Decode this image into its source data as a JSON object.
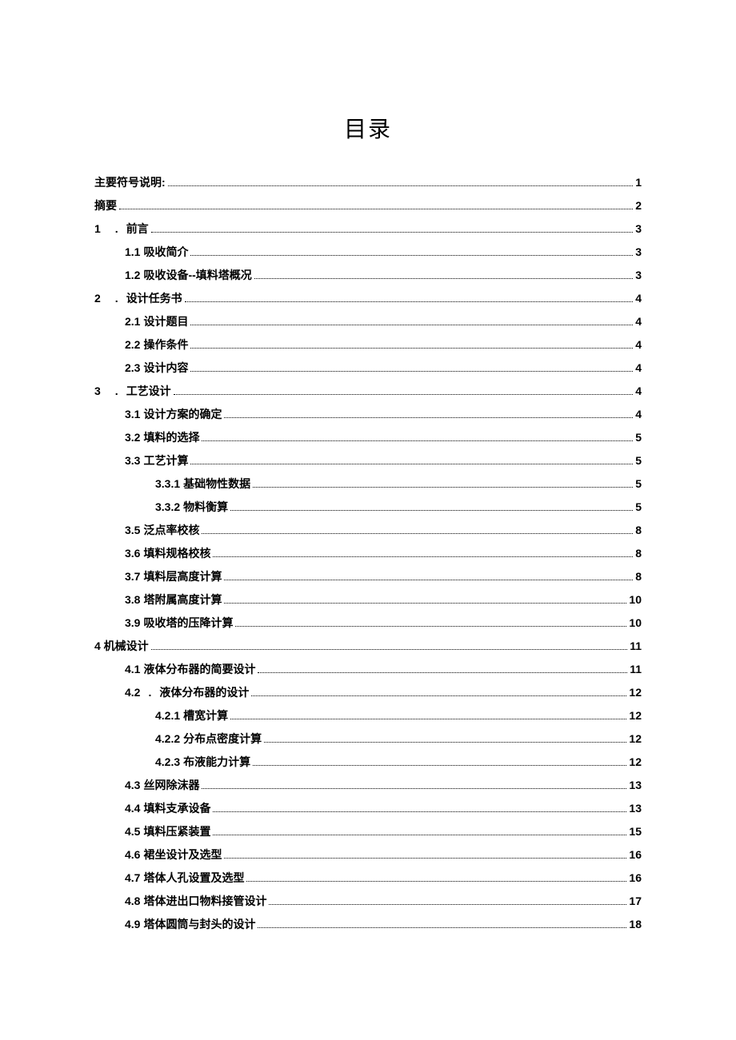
{
  "title": "目录",
  "toc": [
    {
      "level": 0,
      "num": "",
      "label": "主要符号说明:",
      "page": "1"
    },
    {
      "level": 0,
      "num": "",
      "label": "摘要",
      "page": "2"
    },
    {
      "level": 1,
      "num": "1",
      "sep": ".",
      "label": "前言",
      "page": "3"
    },
    {
      "level": 2,
      "num": "1.1",
      "label": "吸收简介",
      "page": "3"
    },
    {
      "level": 2,
      "num": "1.2",
      "label": "吸收设备--填料塔概况",
      "page": "3"
    },
    {
      "level": 1,
      "num": "2",
      "sep": ".",
      "label": "设计任务书",
      "page": "4"
    },
    {
      "level": 2,
      "num": "2.1",
      "label": "设计题目",
      "page": "4"
    },
    {
      "level": 2,
      "num": "2.2",
      "label": "操作条件",
      "page": "4"
    },
    {
      "level": 2,
      "num": "2.3",
      "label": "设计内容",
      "page": "4"
    },
    {
      "level": 1,
      "num": "3",
      "sep": ".",
      "label": "工艺设计",
      "page": "4"
    },
    {
      "level": 2,
      "num": "3.1",
      "label": "设计方案的确定",
      "page": "4"
    },
    {
      "level": 2,
      "num": "3.2",
      "label": "填料的选择",
      "page": "5"
    },
    {
      "level": 2,
      "num": "3.3",
      "label": "工艺计算",
      "page": "5"
    },
    {
      "level": 3,
      "num": "3.3.1",
      "label": "基础物性数据",
      "page": "5"
    },
    {
      "level": 3,
      "num": "3.3.2",
      "label": "物料衡算",
      "page": "5"
    },
    {
      "level": 2,
      "num": "3.5",
      "label": "泛点率校核",
      "page": "8"
    },
    {
      "level": 2,
      "num": "3.6",
      "label": "填料规格校核",
      "page": "8"
    },
    {
      "level": 2,
      "num": "3.7",
      "label": "填料层高度计算",
      "page": "8"
    },
    {
      "level": 2,
      "num": "3.8",
      "label": "塔附属高度计算",
      "page": "10"
    },
    {
      "level": 2,
      "num": "3.9",
      "label": "吸收塔的压降计算",
      "page": "10"
    },
    {
      "level": 0,
      "num": "",
      "label": "4 机械设计",
      "page": "11"
    },
    {
      "level": 2,
      "num": "4.1",
      "label": "液体分布器的简要设计",
      "page": "11"
    },
    {
      "level": 2,
      "num": "4.2",
      "sep": ".",
      "label": "液体分布器的设计",
      "page": "12"
    },
    {
      "level": 3,
      "num": "4.2.1",
      "label": "槽宽计算",
      "page": "12"
    },
    {
      "level": 3,
      "num": "4.2.2",
      "label": "分布点密度计算",
      "page": "12"
    },
    {
      "level": 3,
      "num": "4.2.3",
      "label": "布液能力计算",
      "page": "12"
    },
    {
      "level": 2,
      "num": "4.3",
      "label": "丝网除沫器",
      "page": "13"
    },
    {
      "level": 2,
      "num": "4.4",
      "label": "填料支承设备",
      "page": "13"
    },
    {
      "level": 2,
      "num": "4.5",
      "label": "填料压紧装置",
      "page": "15"
    },
    {
      "level": 2,
      "num": "4.6",
      "label": "裙坐设计及选型",
      "page": "16"
    },
    {
      "level": 2,
      "num": "4.7",
      "label": "塔体人孔设置及选型",
      "page": "16"
    },
    {
      "level": 2,
      "num": "4.8",
      "label": "塔体进出口物料接管设计",
      "page": "17"
    },
    {
      "level": 2,
      "num": "4.9",
      "label": "塔体圆筒与封头的设计",
      "page": "18"
    }
  ]
}
